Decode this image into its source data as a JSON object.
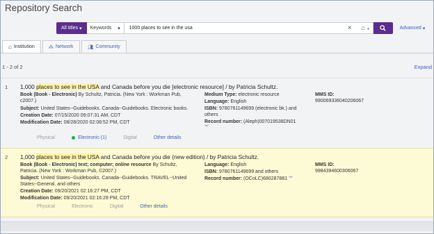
{
  "header": {
    "title": "Repository Search"
  },
  "search": {
    "scope_label": "All titles",
    "field_label": "Keywords",
    "query": "1000 places to see in the usa",
    "advanced_label": "Advanced"
  },
  "tabs": [
    {
      "label": "Institution"
    },
    {
      "label": "Network"
    },
    {
      "label": "Community"
    }
  ],
  "results_count": "1 - 2 of 2",
  "expand_label": "Expand",
  "results": [
    {
      "number": "1",
      "title_pre": "1,000 ",
      "title_hl1": "places to see in the USA",
      "title_mid": " and Canada before you die [electronic resource] / by Patricia Schultz.",
      "col1": {
        "type_label": "Book (Book - Electronic)",
        "type_rest": " By Schultz, Patricia. (New York : Workman Pub, c2007.)",
        "subject_label": "Subject:",
        "subject": " United States--Guidebooks. Canada--Guidebooks. Electronic books.",
        "created_label": "Creation Date:",
        "created": " 07/15/2020 09:07:31 AM, CDT",
        "modified_label": "Modification Date:",
        "modified": " 08/28/2020 02:08:52 PM, CDT"
      },
      "col2": {
        "medium_label": "Medium Type:",
        "medium": " electronic resource",
        "language_label": "Language:",
        "language": " English",
        "isbn_label": "ISBN:",
        "isbn": " 9780761149699 (electronic bk.) and others",
        "record_label": "Record number:",
        "record": " (Aleph)007019538DN01"
      },
      "col3": {
        "mms_label": "MMS ID:",
        "mms": "990069336040206067"
      },
      "actions": {
        "physical": "Physical",
        "electronic": "Electronic (1)",
        "digital": "Digital",
        "other": "Other details"
      }
    },
    {
      "number": "2",
      "title_pre": "1,000 ",
      "title_hl1": "places to see in the USA",
      "title_mid": " and Canada before you die (new edition) / by Patricia Schultz.",
      "col1": {
        "type_label": "Book (Book - Electronic) text; computer; online resource",
        "type_rest": " By Schultz, Patricia. (New York : Workman Pub, ©2007.)",
        "subject_label": "Subject:",
        "subject": " United States--Guidebooks. Canada--Guidebooks. TRAVEL--United States--General. and others",
        "created_label": "Creation Date:",
        "created": " 09/20/2021 02:16:27 PM, CDT",
        "modified_label": "Modification Date:",
        "modified": " 09/20/2021 02:16:28 PM, CDT"
      },
      "col2": {
        "language_label": "Language:",
        "language": " English",
        "isbn_label": "ISBN:",
        "isbn": " 9780761149699 and others",
        "record_label": "Record number:",
        "record": " (OCoLC)680287881"
      },
      "col3": {
        "mms_label": "MMS ID:",
        "mms": "9984394600306067"
      },
      "actions": {
        "physical": "Physical",
        "electronic": "Electronic",
        "digital": "Digital",
        "other": "Other details"
      }
    }
  ],
  "colors": {
    "accent": "#5b2d8e",
    "link": "#3d5fb0",
    "highlight_row": "#fdfbd5",
    "available": "#22a54a"
  }
}
